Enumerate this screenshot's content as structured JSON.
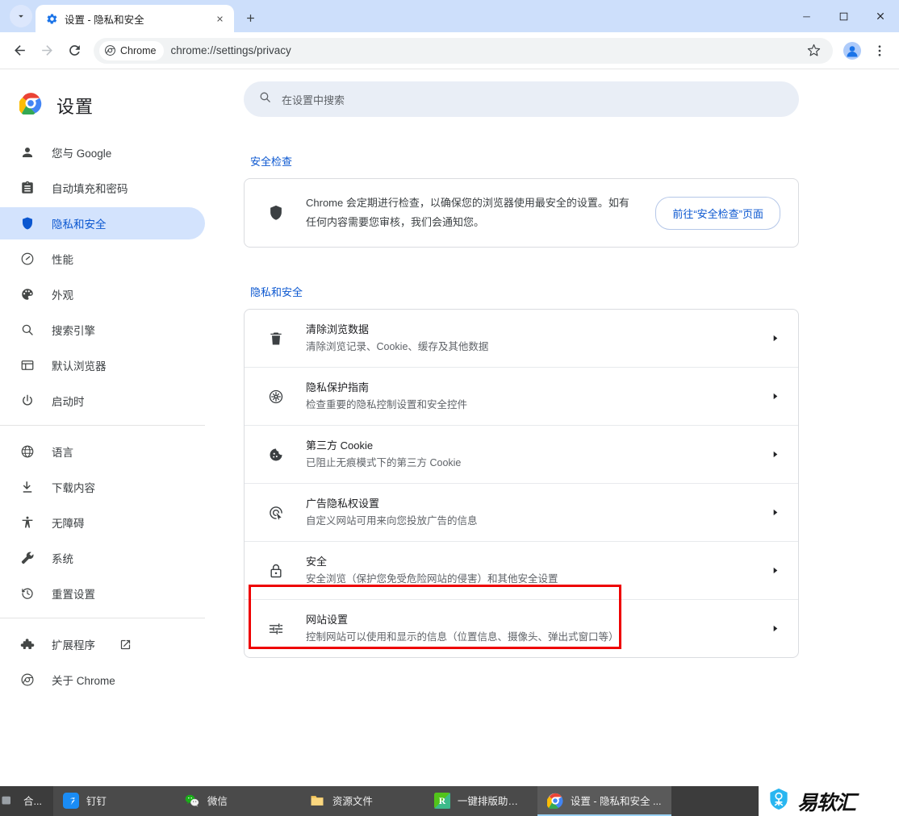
{
  "window": {
    "tab": {
      "title": "设置 - 隐私和安全",
      "favicon_icon": "gear-icon",
      "close_icon": "close-icon"
    },
    "tab_search_icon": "chevron-down-icon",
    "new_tab_icon": "plus-icon",
    "controls": {
      "minimize": "minimize-icon",
      "maximize": "maximize-icon",
      "close": "close-icon"
    }
  },
  "toolbar": {
    "back_icon": "back-arrow-icon",
    "forward_icon": "forward-arrow-icon",
    "reload_icon": "reload-icon",
    "chrome_pill_label": "Chrome",
    "url": "chrome://settings/privacy",
    "bookmark_icon": "star-icon",
    "profile_icon": "avatar-icon",
    "menu_icon": "three-dot-menu-icon"
  },
  "sidebar": {
    "brand_title": "设置",
    "brand_icon": "chrome-logo-icon",
    "items": [
      {
        "label": "您与 Google",
        "icon": "person-icon",
        "selected": false
      },
      {
        "label": "自动填充和密码",
        "icon": "clipboard-icon",
        "selected": false
      },
      {
        "label": "隐私和安全",
        "icon": "shield-icon",
        "selected": true
      },
      {
        "label": "性能",
        "icon": "speedometer-icon",
        "selected": false
      },
      {
        "label": "外观",
        "icon": "palette-icon",
        "selected": false
      },
      {
        "label": "搜索引擎",
        "icon": "magnifier-icon",
        "selected": false
      },
      {
        "label": "默认浏览器",
        "icon": "browser-window-icon",
        "selected": false
      },
      {
        "label": "启动时",
        "icon": "power-icon",
        "selected": false
      }
    ],
    "items2": [
      {
        "label": "语言",
        "icon": "globe-icon"
      },
      {
        "label": "下载内容",
        "icon": "download-icon"
      },
      {
        "label": "无障碍",
        "icon": "accessibility-icon"
      },
      {
        "label": "系统",
        "icon": "wrench-icon"
      },
      {
        "label": "重置设置",
        "icon": "history-restore-icon"
      }
    ],
    "items3": [
      {
        "label": "扩展程序",
        "icon": "puzzle-icon",
        "external": true,
        "external_icon": "open-in-new-icon"
      },
      {
        "label": "关于 Chrome",
        "icon": "chrome-outline-icon",
        "external": false
      }
    ]
  },
  "search": {
    "placeholder": "在设置中搜索",
    "icon": "search-icon"
  },
  "safety_check": {
    "section_title": "安全检查",
    "icon": "shield-icon",
    "description": "Chrome 会定期进行检查，以确保您的浏览器使用最安全的设置。如有任何内容需要您审核，我们会通知您。",
    "button_label": "前往“安全检查”页面"
  },
  "privacy": {
    "section_title": "隐私和安全",
    "rows": [
      {
        "title": "清除浏览数据",
        "sub": "清除浏览记录、Cookie、缓存及其他数据",
        "icon": "trash-icon",
        "chevron": "chevron-right-icon"
      },
      {
        "title": "隐私保护指南",
        "sub": "检查重要的隐私控制设置和安全控件",
        "icon": "privacy-guide-icon",
        "chevron": "chevron-right-icon"
      },
      {
        "title": "第三方 Cookie",
        "sub": "已阻止无痕模式下的第三方 Cookie",
        "icon": "cookie-icon",
        "chevron": "chevron-right-icon"
      },
      {
        "title": "广告隐私权设置",
        "sub": "自定义网站可用来向您投放广告的信息",
        "icon": "ad-privacy-icon",
        "chevron": "chevron-right-icon"
      },
      {
        "title": "安全",
        "sub": "安全浏览（保护您免受危险网站的侵害）和其他安全设置",
        "icon": "lock-icon",
        "chevron": "chevron-right-icon"
      },
      {
        "title": "网站设置",
        "sub": "控制网站可以使用和显示的信息（位置信息、摄像头、弹出式窗口等）",
        "icon": "sliders-icon",
        "chevron": "chevron-right-icon",
        "highlighted": true
      }
    ]
  },
  "highlight": {
    "color": "#ee0000"
  },
  "taskbar": {
    "items": [
      {
        "label": "合...",
        "icon": "app-icon",
        "state": "clipped"
      },
      {
        "label": "钉钉",
        "icon": "dingtalk-icon",
        "state": "pinned"
      },
      {
        "label": "微信",
        "icon": "wechat-icon",
        "state": "pinned"
      },
      {
        "label": "资源文件",
        "icon": "folder-icon",
        "state": "pinned"
      },
      {
        "label": "一键排版助手(MyE...",
        "icon": "r-app-icon",
        "state": "pinned"
      },
      {
        "label": "设置 - 隐私和安全 ...",
        "icon": "chrome-logo-icon",
        "state": "active"
      }
    ],
    "watermark": {
      "text": "易软汇",
      "icon": "yiruanhui-logo-icon",
      "color": "#29b6f0"
    }
  },
  "colors": {
    "accent": "#0b57d0",
    "tabstrip": "#cddffb",
    "selected_nav_bg": "#d3e3fd",
    "search_bg": "#e9eef6",
    "taskbar_bg": "#3c3c3c"
  }
}
